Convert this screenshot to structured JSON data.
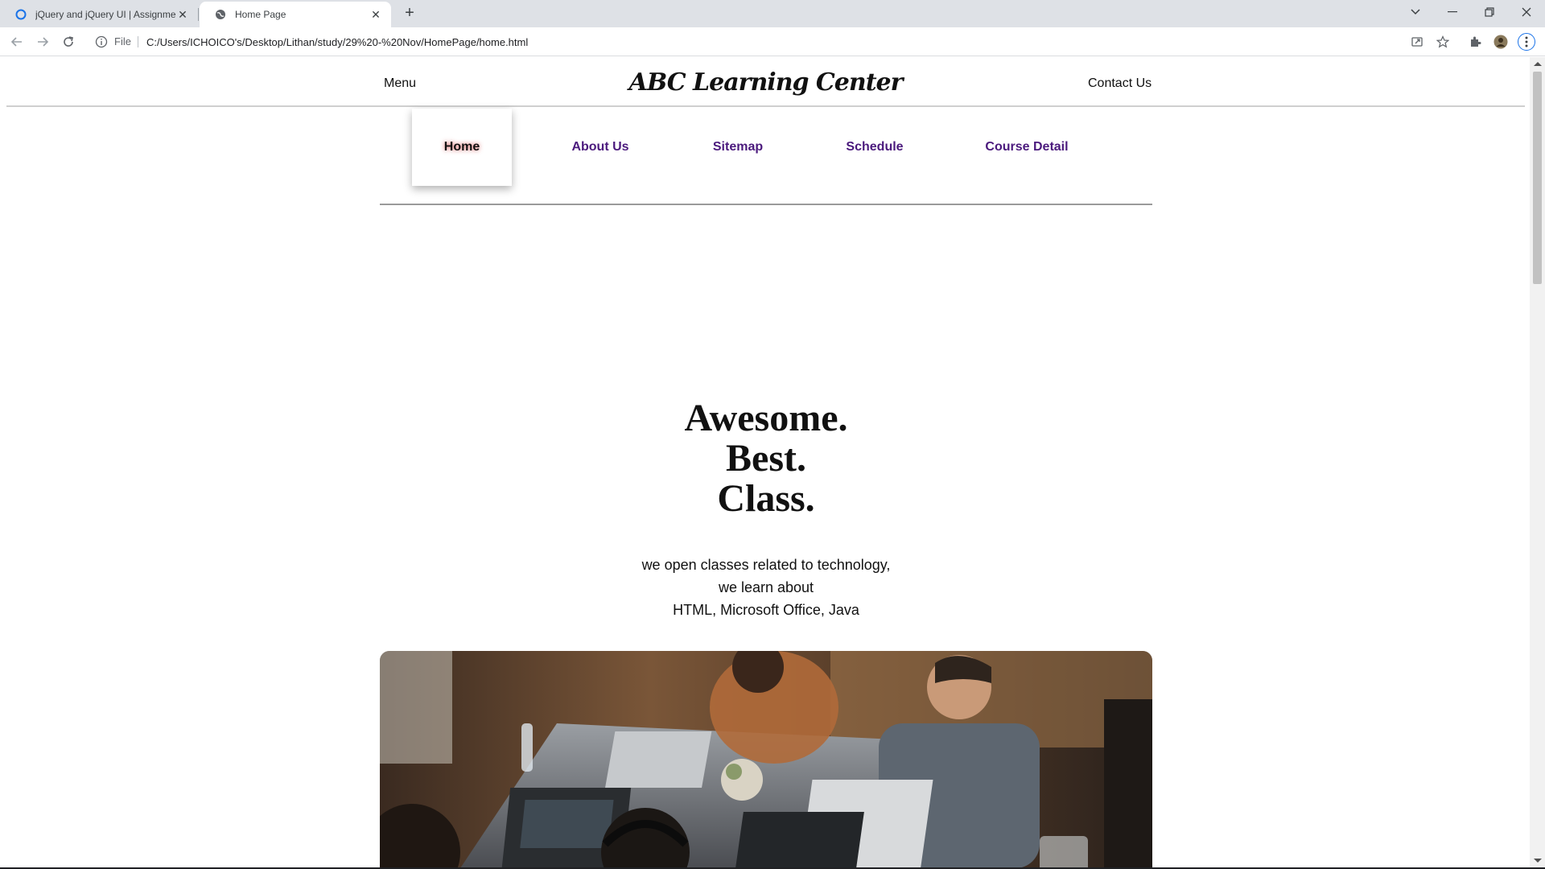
{
  "browser": {
    "tabs": [
      {
        "title": "jQuery and jQuery UI | Assignme",
        "active": false
      },
      {
        "title": "Home Page",
        "active": true
      }
    ],
    "address": {
      "scheme_label": "File",
      "url": "C:/Users/ICHOICO's/Desktop/Lithan/study/29%20-%20Nov/HomePage/home.html"
    },
    "icons": [
      "back-icon",
      "forward-icon",
      "reload-icon",
      "info-icon",
      "share-icon",
      "star-icon",
      "extensions-icon",
      "profile-icon",
      "kebab-menu-icon",
      "tab-search-icon",
      "minimize-icon",
      "restore-icon",
      "close-icon"
    ]
  },
  "page": {
    "header": {
      "menu_label": "Menu",
      "brand": "ABC Learning Center",
      "contact_label": "Contact Us"
    },
    "nav": {
      "items": [
        {
          "label": "Home",
          "active": true
        },
        {
          "label": "About Us",
          "active": false
        },
        {
          "label": "Sitemap",
          "active": false
        },
        {
          "label": "Schedule",
          "active": false
        },
        {
          "label": "Course Detail",
          "active": false
        }
      ]
    },
    "hero": {
      "lines": [
        "Awesome.",
        "Best.",
        "Class."
      ]
    },
    "subtitle": {
      "lines": [
        "we open classes related to technology,",
        "we learn about",
        "HTML, Microsoft Office, Java"
      ]
    },
    "colors": {
      "nav_link": "#4b1a7d",
      "active_glow": "#d22828",
      "tab_strip": "#dee1e6"
    }
  }
}
